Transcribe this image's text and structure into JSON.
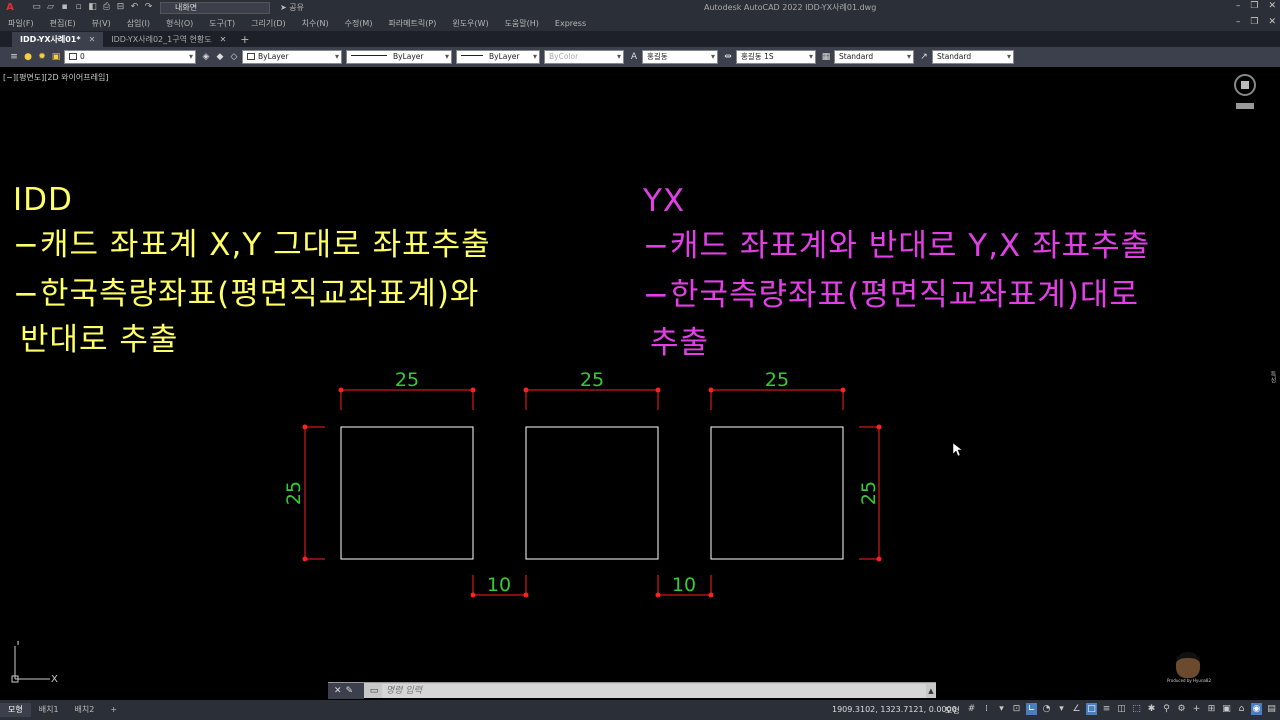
{
  "app": {
    "logo": "A",
    "title": "Autodesk AutoCAD 2022    IDD-YX사례01.dwg",
    "workspace": "내화면",
    "share": "공유"
  },
  "menu": [
    "파일(F)",
    "편집(E)",
    "뷰(V)",
    "삽입(I)",
    "형식(O)",
    "도구(T)",
    "그리기(D)",
    "치수(N)",
    "수정(M)",
    "파라메트릭(P)",
    "윈도우(W)",
    "도움말(H)",
    "Express"
  ],
  "tabs": [
    {
      "label": "IDD-YX사례01*",
      "active": true
    },
    {
      "label": "IDD-YX사례02_1구역 현황도",
      "active": false
    }
  ],
  "toolbar": {
    "layer": "0",
    "color": "ByLayer",
    "linetype": "ByLayer",
    "lineweight": "ByLayer",
    "plotstyle": "ByColor",
    "textstyle": "홍길동",
    "dimstyle": "홍길동 1S",
    "tablestyle": "Standard",
    "mleaderstyle": "Standard"
  },
  "viewport": {
    "label": "[−][평면도][2D 와이어프레임]",
    "notes_left": {
      "title": "IDD",
      "line1": "−캐드 좌표계 X,Y 그대로 좌표추출",
      "line2": "−한국측량좌표(평면직교좌표계)와",
      "line3": " 반대로 추출"
    },
    "notes_right": {
      "title": "YX",
      "line1": "−캐드 좌표계와 반대로 Y,X 좌표추출",
      "line2": "−한국측량좌표(평면직교좌표계)대로",
      "line3": " 추출"
    },
    "dimensions": {
      "top": [
        "25",
        "25",
        "25"
      ],
      "left": "25",
      "right": "25",
      "gaps": [
        "10",
        "10"
      ]
    },
    "ucs_x": "X",
    "ucs_y": "Y",
    "right_strip": "특성"
  },
  "command": {
    "placeholder": "명령 입력"
  },
  "status": {
    "layouts": [
      "모형",
      "배치1",
      "배치2"
    ],
    "coords": "1909.3102, 1323.7121, 0.0000",
    "model": "모형"
  },
  "watermark": "Produced by Hyuna82",
  "colors": {
    "yellow_text": "#ffff66",
    "magenta_text": "#e23fe6",
    "dim_text": "#33cc33",
    "dim_line": "#ff2020",
    "geometry": "#ffffff"
  }
}
